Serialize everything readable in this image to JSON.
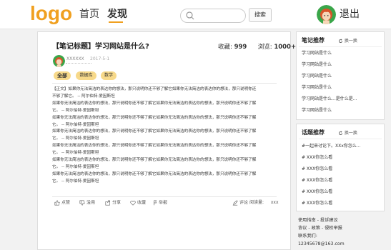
{
  "header": {
    "logo": "logo",
    "nav": [
      "首页",
      "发现"
    ],
    "search_placeholder": "",
    "search_button": "搜索",
    "logout": "退出"
  },
  "post": {
    "title": "【笔记标题】学习网站是什么?",
    "favorites_label": "收藏:",
    "favorites_value": "999",
    "views_label": "浏览:",
    "views_value": "1000+",
    "author": "XXXXXX",
    "date": "2017-5-1",
    "tags": [
      "全部",
      "数据库",
      "数学"
    ],
    "content": [
      "【正文】如果你无法简洁的表达你的想法，那只说明你还不够了解它如果你无法简洁的表达你的想法，那只说明你还",
      "不够了解它。 -- 阿尔伯特·爱因斯坦",
      "如果你无法简洁的表达你的想法，那只说明你还不够了解它如果你无法简洁的表达你的想法，那只说明你还不够了解",
      "它。 -- 阿尔伯特·爱因斯坦",
      "如果你无法简洁的表达你的想法，那只说明你还不够了解它如果你无法简洁的表达你的想法，那只说明你还不够了解",
      "它。 -- 阿尔伯特·爱因斯坦",
      "如果你无法简洁的表达你的想法，那只说明你还不够了解它如果你无法简洁的表达你的想法，那只说明你还不够了解",
      "它。 -- 阿尔伯特·爱因斯坦",
      "如果你无法简洁的表达你的想法，那只说明你还不够了解它如果你无法简洁的表达你的想法，那只说明你还不够了解",
      "它。 -- 阿尔伯特·爱因斯坦",
      "如果你无法简洁的表达你的想法，那只说明你还不够了解它如果你无法简洁的表达你的想法，那只说明你还不够了解",
      "它。 -- 阿尔伯特·爱因斯坦",
      "如果你无法简洁的表达你的想法，那只说明你还不够了解它如果你无法简洁的表达你的想法，那只说明你还不够了解",
      "它。 -- 阿尔伯特·爱因斯坦"
    ],
    "actions": {
      "like": "点赞",
      "dislike": "没用",
      "share": "分享",
      "collect": "收藏",
      "report": "举报",
      "review": "评论",
      "read_label": "阅读量:",
      "read_value": "xxx"
    }
  },
  "notes_recommend": {
    "title": "笔记推荐",
    "refresh": "换一换",
    "items": [
      "学习网站是什么",
      "学习网站是什么",
      "学习网站是什么",
      "学习网站是什么",
      "学习网站是什么...是什么是...",
      "学习网站是什么",
      "学习网站是什么"
    ]
  },
  "topics_recommend": {
    "title": "话题推荐",
    "refresh": "换一换",
    "items": [
      "#一起来讨论下。XXx你怎么...",
      "# XXX你怎么看",
      "# XXX你怎么看",
      "# XXX你怎么看",
      "# XXX你怎么看",
      "# XXX你怎么看"
    ]
  },
  "footer": {
    "line1": "使用指南 - 投诉建议",
    "line2": "协议 - 政策 - 侵权举报",
    "line3": "联系我们:",
    "line4": "12345678@163.com"
  },
  "colors": {
    "accent": "#f0a020",
    "tag_bg": "#f7d98a",
    "avatar_bg": "#3aa64a",
    "avatar_hair": "#d9542a",
    "avatar_face": "#f6d7b8"
  },
  "icons": [
    "search-icon",
    "refresh-icon",
    "like-icon",
    "dislike-icon",
    "share-icon",
    "heart-icon",
    "report-icon",
    "edit-icon",
    "avatar"
  ]
}
